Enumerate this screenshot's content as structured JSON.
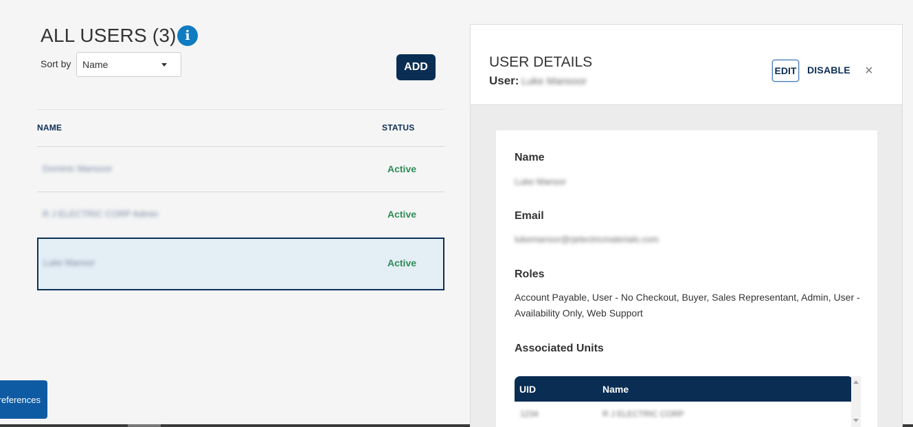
{
  "users_list": {
    "title": "ALL USERS (3)",
    "sort_label": "Sort by",
    "sort_value": "Name",
    "add_label": "ADD",
    "columns": {
      "name": "NAME",
      "status": "STATUS"
    },
    "rows": [
      {
        "name": "Dominic Mansoor",
        "status": "Active"
      },
      {
        "name": "R J ELECTRIC CORP Admin",
        "status": "Active"
      },
      {
        "name": "Luke Mansor",
        "status": "Active"
      }
    ]
  },
  "preferences_label": "Preferences",
  "details": {
    "title": "USER DETAILS",
    "user_label": "User:",
    "user_value": "Luke Mansoor",
    "edit_label": "EDIT",
    "disable_label": "DISABLE",
    "close_icon": "×",
    "name_label": "Name",
    "name_value": "Luke Mansor",
    "email_label": "Email",
    "email_value": "lukemansor@rjelectricmaterials.com",
    "roles_label": "Roles",
    "roles_value": "Account Payable, User - No Checkout, Buyer, Sales Representant, Admin, User - Availability Only, Web Support",
    "units_label": "Associated Units",
    "units_columns": {
      "uid": "UID",
      "name": "Name"
    },
    "units_rows": [
      {
        "uid": "1234",
        "name": "R J ELECTRIC CORP"
      }
    ]
  },
  "colors": {
    "primary": "#0a2d54",
    "active_status": "#2e8b57",
    "info_icon": "#0f7bc1",
    "selected_row_bg": "#e4eef5"
  }
}
